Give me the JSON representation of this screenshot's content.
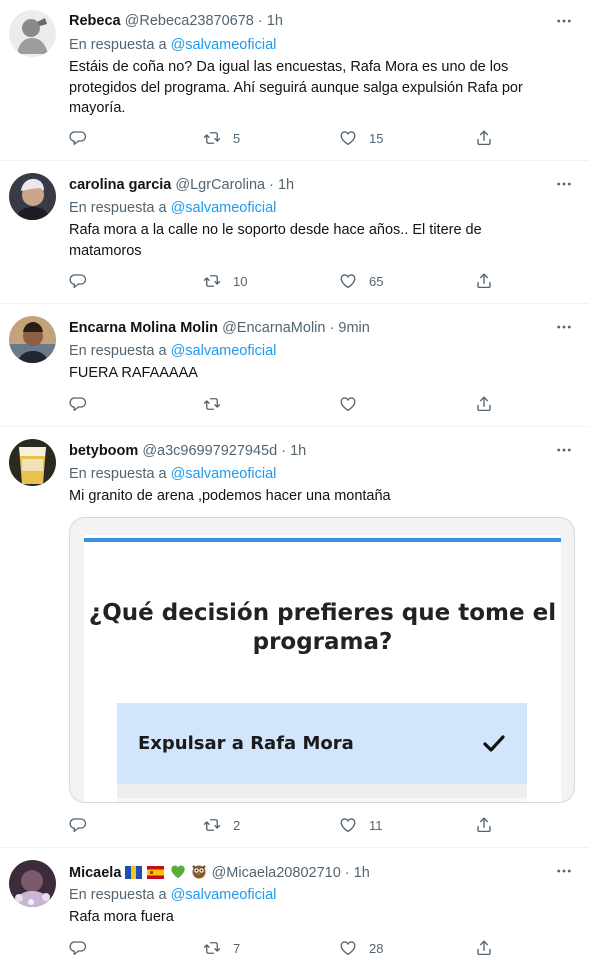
{
  "reply_prefix": "En respuesta a",
  "reply_mention": "@salvameoficial",
  "tweets": [
    {
      "name": "Rebeca",
      "handle": "@Rebeca23870678",
      "sep": "·",
      "time": "1h",
      "text": "Estáis de coña no? Da igual las encuestas, Rafa Mora es uno de los protegidos del programa. Ahí seguirá aunque salga expulsión Rafa por mayoría.",
      "retweets": "5",
      "likes": "15"
    },
    {
      "name": "carolina garcia",
      "handle": "@LgrCarolina",
      "sep": "·",
      "time": "1h",
      "text": "Rafa mora a la calle no le soporto desde hace años.. El titere de matamoros",
      "retweets": "10",
      "likes": "65"
    },
    {
      "name": "Encarna Molina Molin",
      "handle": "@EncarnaMolin",
      "sep": "·",
      "time": "9min",
      "text": "FUERA RAFAAAAA",
      "retweets": "",
      "likes": ""
    },
    {
      "name": "betyboom",
      "handle": "@a3c96997927945d",
      "sep": "·",
      "time": "1h",
      "text": "Mi granito de arena ,podemos hacer una montaña",
      "retweets": "2",
      "likes": "11",
      "card": {
        "question": "¿Qué decisión prefieres que tome el programa?",
        "option": "Expulsar a Rafa Mora"
      }
    },
    {
      "name": "Micaela",
      "name_emojis": [
        "blue-yellow-flag",
        "spain-flag",
        "green-heart",
        "owl"
      ],
      "handle": "@Micaela20802710",
      "sep": "·",
      "time": "1h",
      "text": "Rafa mora fuera",
      "retweets": "7",
      "likes": "28"
    }
  ],
  "colors": {
    "accent": "#1d9bf0",
    "secondary_text": "#536471",
    "divider": "#eff3f4",
    "poll_option_bg": "#d2e5fb",
    "poll_topbar": "#3d8fe3"
  },
  "icons": [
    "more-icon",
    "reply-icon",
    "retweet-icon",
    "like-icon",
    "share-icon",
    "check-icon"
  ]
}
